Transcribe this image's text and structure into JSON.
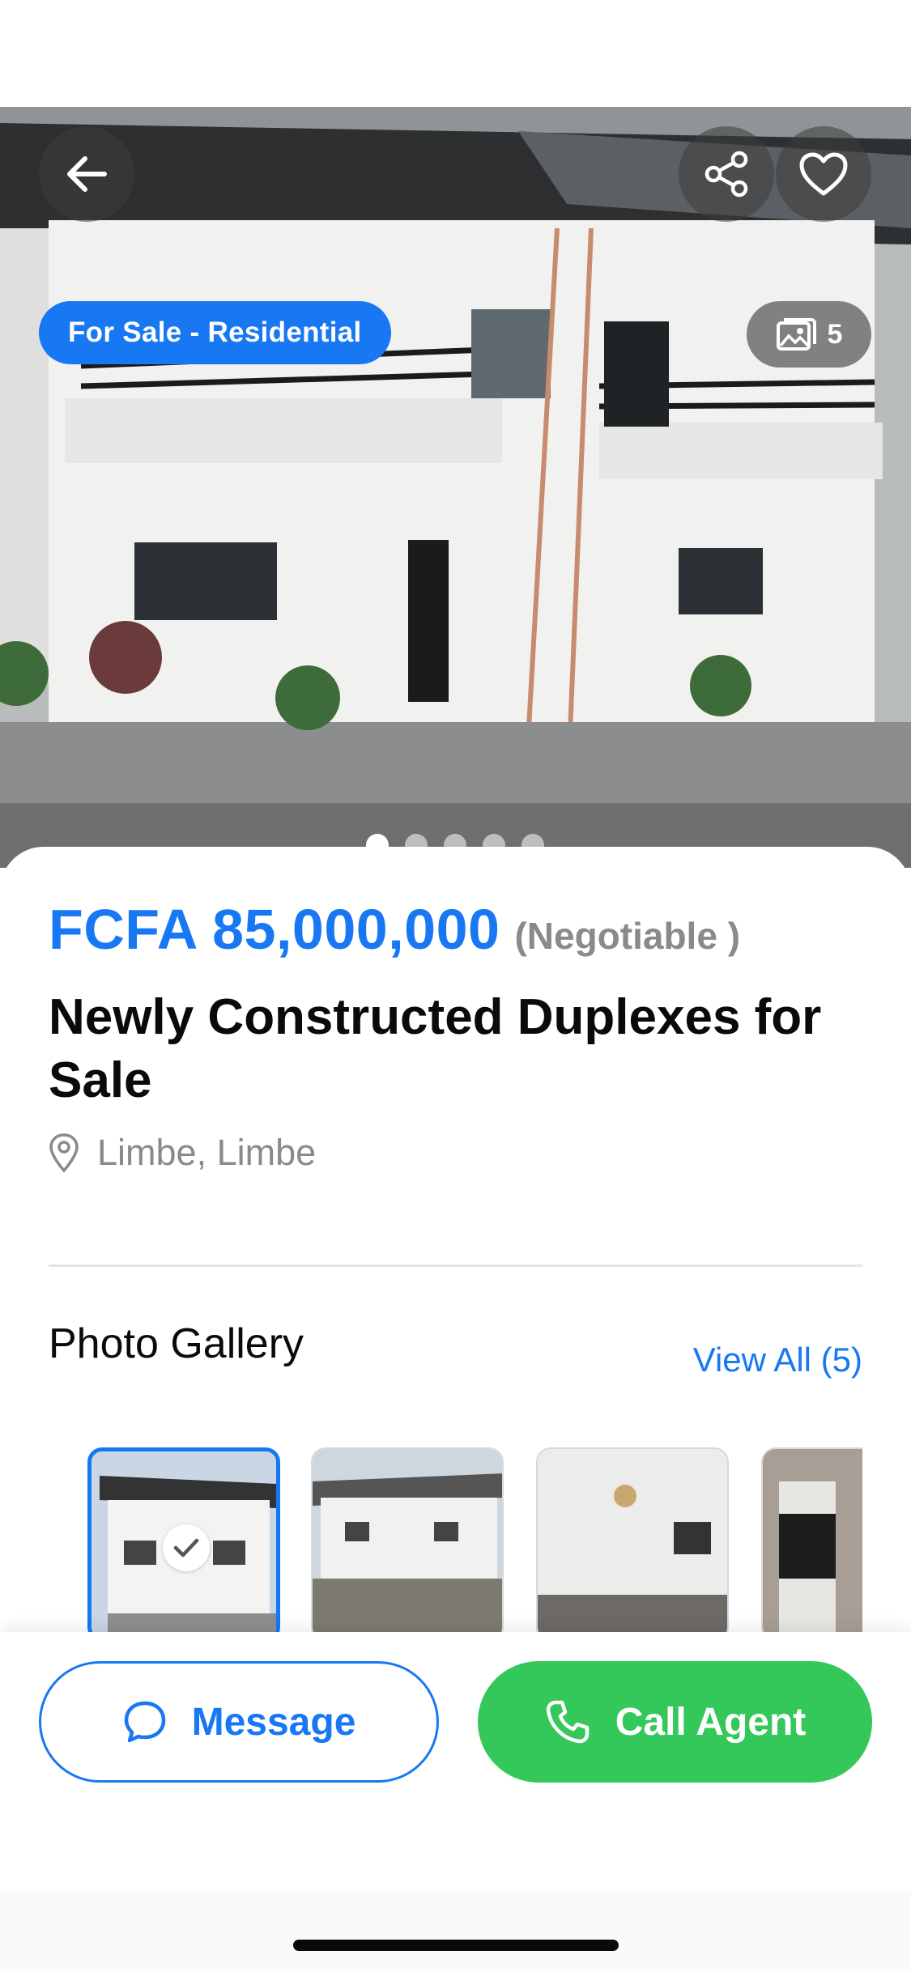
{
  "listing": {
    "tag": "For Sale - Residential",
    "photo_count": "5",
    "price": "FCFA 85,000,000",
    "negotiable": "(Negotiable )",
    "title": "Newly Constructed Duplexes for Sale",
    "location": "Limbe, Limbe",
    "carousel_total": 5,
    "carousel_active": 1
  },
  "gallery": {
    "title": "Photo Gallery",
    "view_all": "View All (5)",
    "selected_index": 0
  },
  "actions": {
    "message": "Message",
    "call": "Call Agent"
  },
  "icons": {
    "back": "arrow-left-icon",
    "share": "share-icon",
    "favorite": "heart-icon",
    "photos": "image-icon",
    "location": "location-pin-icon",
    "check": "checkmark-icon",
    "message": "chat-bubble-icon",
    "call": "phone-icon"
  },
  "colors": {
    "accent": "#1877f2",
    "call_button": "#34c759",
    "muted_text": "#8a8a8e"
  }
}
